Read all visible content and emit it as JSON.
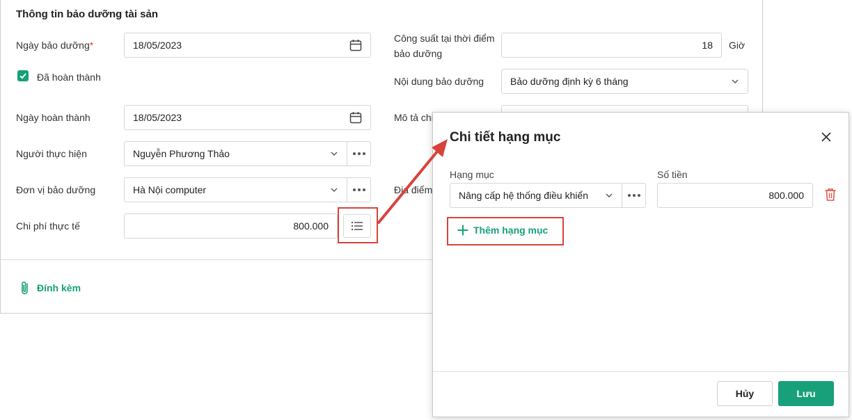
{
  "form": {
    "title": "Thông tin bảo dưỡng tài sản",
    "maintenance_date_label": "Ngày bảo dưỡng",
    "required_mark": "*",
    "maintenance_date_value": "18/05/2023",
    "completed_label": "Đã hoàn thành",
    "completed_checked": true,
    "completion_date_label": "Ngày hoàn thành",
    "completion_date_value": "18/05/2023",
    "performer_label": "Người thực hiện",
    "performer_value": "Nguyễn Phương Thảo",
    "unit_label": "Đơn vị bảo dưỡng",
    "unit_value": "Hà Nội computer",
    "cost_label": "Chi phí thực tế",
    "cost_value": "800.000",
    "capacity_label_1": "Công suất tại thời điểm",
    "capacity_label_2": "bảo dưỡng",
    "capacity_value": "18",
    "capacity_unit": "Giờ",
    "content_label": "Nội dung bảo dưỡng",
    "content_value": "Bảo dưỡng định kỳ 6 tháng",
    "description_label_partial": "Mô tả chi",
    "location_label_partial": "Địa điểm b",
    "attach_label": "Đính kèm"
  },
  "modal": {
    "title": "Chi tiết hạng mục",
    "item_label": "Hạng mục",
    "amount_label": "Số tiền",
    "item_value": "Nâng cấp hệ thống điều khiển",
    "amount_value": "800.000",
    "add_item_label": "Thêm hạng mục",
    "cancel_label": "Hủy",
    "save_label": "Lưu"
  },
  "colors": {
    "accent": "#17a07a",
    "highlight": "#d9423b",
    "required": "#e53935"
  }
}
